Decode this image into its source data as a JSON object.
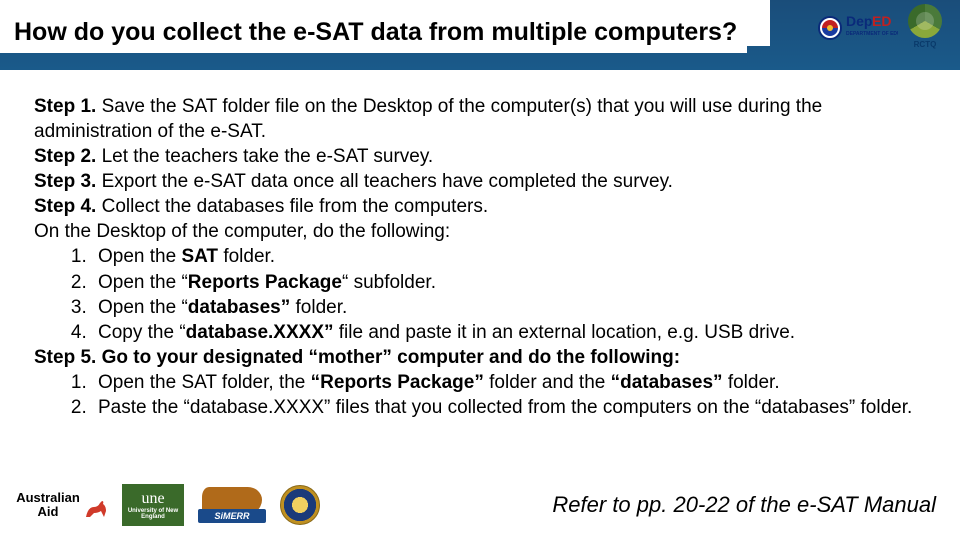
{
  "header": {
    "title": "How do you collect the e-SAT data from multiple computers?",
    "logos": {
      "deped_alt": "DepED",
      "rctq_label": "RCTQ"
    }
  },
  "body": {
    "step1": {
      "label": "Step 1.",
      "text": " Save the SAT folder file on the Desktop of the computer(s) that you will use during the administration of the e-SAT."
    },
    "step2": {
      "label": "Step 2.",
      "text": " Let the teachers take the e-SAT survey."
    },
    "step3": {
      "label": "Step 3.",
      "text": " Export the e-SAT data once all teachers have completed the survey."
    },
    "step4": {
      "label": "Step 4.",
      "text": " Collect the databases file from the computers."
    },
    "step4_sub_intro": "On the Desktop of the computer, do the following:",
    "step4_items": [
      {
        "pre": "Open the ",
        "bold": "SAT",
        "post": " folder."
      },
      {
        "pre": "Open the “",
        "bold": "Reports Package",
        "post": "“ subfolder."
      },
      {
        "pre": "Open the “",
        "bold": "databases”",
        "post": " folder."
      },
      {
        "pre": "Copy the “",
        "bold": "database.XXXX”",
        "post": " file and paste it in an external location, e.g. USB drive."
      }
    ],
    "step5": {
      "label": "Step 5.",
      "text": " Go to your designated “mother” computer and do the following:"
    },
    "step5_items": [
      {
        "pre": "Open the SAT folder, the ",
        "bold": "“Reports Package”",
        "mid": " folder and the ",
        "bold2": "“databases”",
        "post": " folder."
      },
      {
        "pre": "Paste the “database.XXXX” files that you collected from the computers on the “databases” folder.",
        "bold": "",
        "mid": "",
        "bold2": "",
        "post": ""
      }
    ]
  },
  "footer": {
    "logos": {
      "ausaid_line1": "Australian",
      "ausaid_line2": "Aid",
      "une_small": "University of New England",
      "une_big": "une",
      "simerr": "SiMERR"
    },
    "reference": "Refer to pp. 20-22 of the e-SAT Manual"
  }
}
